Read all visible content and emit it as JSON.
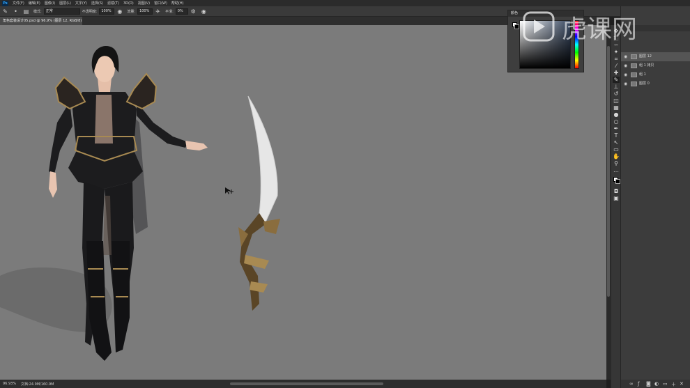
{
  "app": {
    "logo": "Ps"
  },
  "menu": [
    "文件(F)",
    "编辑(E)",
    "图像(I)",
    "图层(L)",
    "文字(Y)",
    "选择(S)",
    "滤镜(T)",
    "3D(D)",
    "视图(V)",
    "窗口(W)",
    "帮助(H)"
  ],
  "options": {
    "mode_label": "模式:",
    "mode_value": "正常",
    "opacity_label": "不透明度:",
    "opacity_value": "100%",
    "flow_label": "流量:",
    "flow_value": "100%",
    "smoothing_label": "平滑:",
    "smoothing_value": "0%"
  },
  "document_tab": {
    "title": "角色套装设计05.psd @ 96.9% (图层 12, RGB/8) *"
  },
  "status": {
    "zoom": "96.93%",
    "doc_info": "文档:24.9M/160.9M"
  },
  "color_panel": {
    "title": "颜色"
  },
  "layers": [
    {
      "name": "图层 12",
      "selected": true
    },
    {
      "name": "组 1 拷贝",
      "selected": false
    },
    {
      "name": "组 1",
      "selected": false
    },
    {
      "name": "图层 0",
      "selected": false
    }
  ],
  "watermark": {
    "text": "虎课网"
  },
  "tools": [
    "move-tool",
    "marquee-tool",
    "lasso-tool",
    "quick-select-tool",
    "crop-tool",
    "eyedropper-tool",
    "healing-tool",
    "brush-tool",
    "stamp-tool",
    "history-brush-tool",
    "eraser-tool",
    "gradient-tool",
    "blur-tool",
    "dodge-tool",
    "pen-tool",
    "type-tool",
    "path-select-tool",
    "rectangle-tool",
    "hand-tool",
    "zoom-tool",
    "more-tools"
  ],
  "colors": {
    "canvas": "#7b7b7b",
    "armor_black": "#1c1c1e",
    "armor_gold": "#a88a52",
    "blade": "#e8e8e8"
  }
}
